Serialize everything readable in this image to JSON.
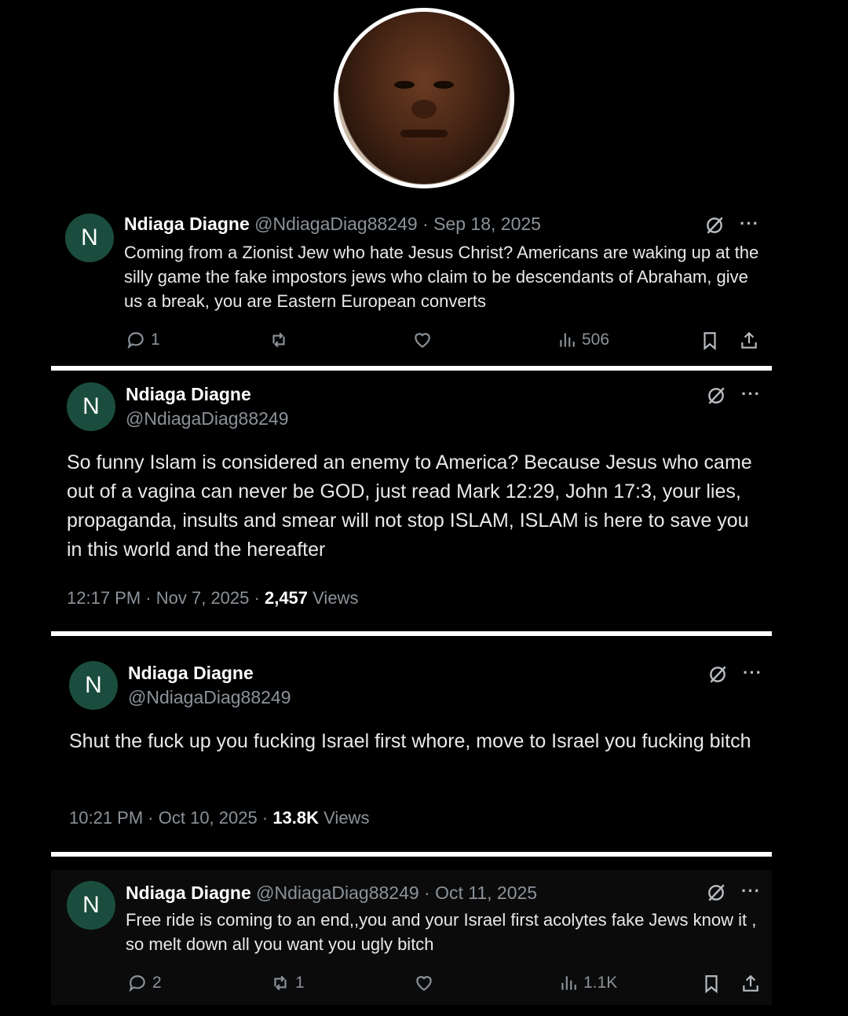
{
  "author": {
    "name": "Ndiaga Diagne",
    "handle": "@NdiagaDiag88249",
    "avatar_initial": "N",
    "avatar_color": "#1b4d3e"
  },
  "posts": [
    {
      "date": "Sep 18, 2025",
      "text": "Coming from a Zionist Jew who hate Jesus Christ? Americans are waking up at the silly game the fake impostors jews who claim to be descendants of Abraham, give us a break, you are Eastern European converts",
      "replies": "1",
      "reposts": "",
      "views": "506"
    },
    {
      "text": "So funny Islam is considered an enemy to America? Because Jesus who came out of a vagina can never be GOD, just read Mark 12:29, John 17:3, your lies, propaganda, insults and smear will not stop ISLAM, ISLAM is here to save you in this world and the hereafter",
      "time": "12:17 PM",
      "date": "Nov 7, 2025",
      "views_count": "2,457",
      "views_label": "Views"
    },
    {
      "text": "Shut the fuck up you fucking Israel first whore, move to Israel you fucking bitch",
      "time": "10:21 PM",
      "date": "Oct 10, 2025",
      "views_count": "13.8K",
      "views_label": "Views"
    },
    {
      "date": "Oct 11, 2025",
      "text": "Free ride is coming  to an end,,you and your Israel first acolytes fake Jews know it , so melt down all you want you ugly bitch",
      "replies": "2",
      "reposts": "1",
      "views": "1.1K"
    }
  ],
  "separator": "·",
  "icons": [
    "grok-icon",
    "more-icon",
    "reply-icon",
    "repost-icon",
    "like-icon",
    "views-icon",
    "bookmark-icon",
    "share-icon"
  ]
}
